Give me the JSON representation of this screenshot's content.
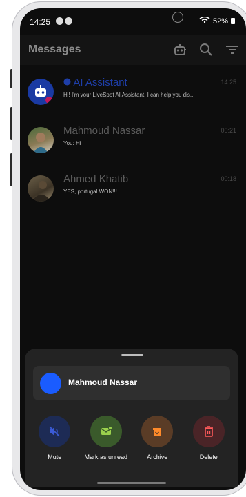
{
  "status": {
    "time": "14:25",
    "signal": "52%"
  },
  "appbar": {
    "title": "Messages"
  },
  "chats": [
    {
      "name": "AI Assistant",
      "preview": "Hi! I'm your LiveSpot AI Assistant. I can help you dis...",
      "time": "14:25"
    },
    {
      "name": "Mahmoud Nassar",
      "preview": "You: Hi",
      "time": "00:21"
    },
    {
      "name": "Ahmed Khatib",
      "preview": "YES, portugal WON!!!",
      "time": "00:18"
    }
  ],
  "sheet": {
    "contact_name": "Mahmoud Nassar",
    "actions": [
      {
        "label": "Mute",
        "color": "#1d2b55"
      },
      {
        "label": "Mark as unread",
        "color": "#3a5a2b"
      },
      {
        "label": "Archive",
        "color": "#5a3c26"
      },
      {
        "label": "Delete",
        "color": "#4a2427"
      }
    ]
  },
  "colors": {
    "accent": "#1a5cff",
    "background": "#0d0d0d"
  }
}
